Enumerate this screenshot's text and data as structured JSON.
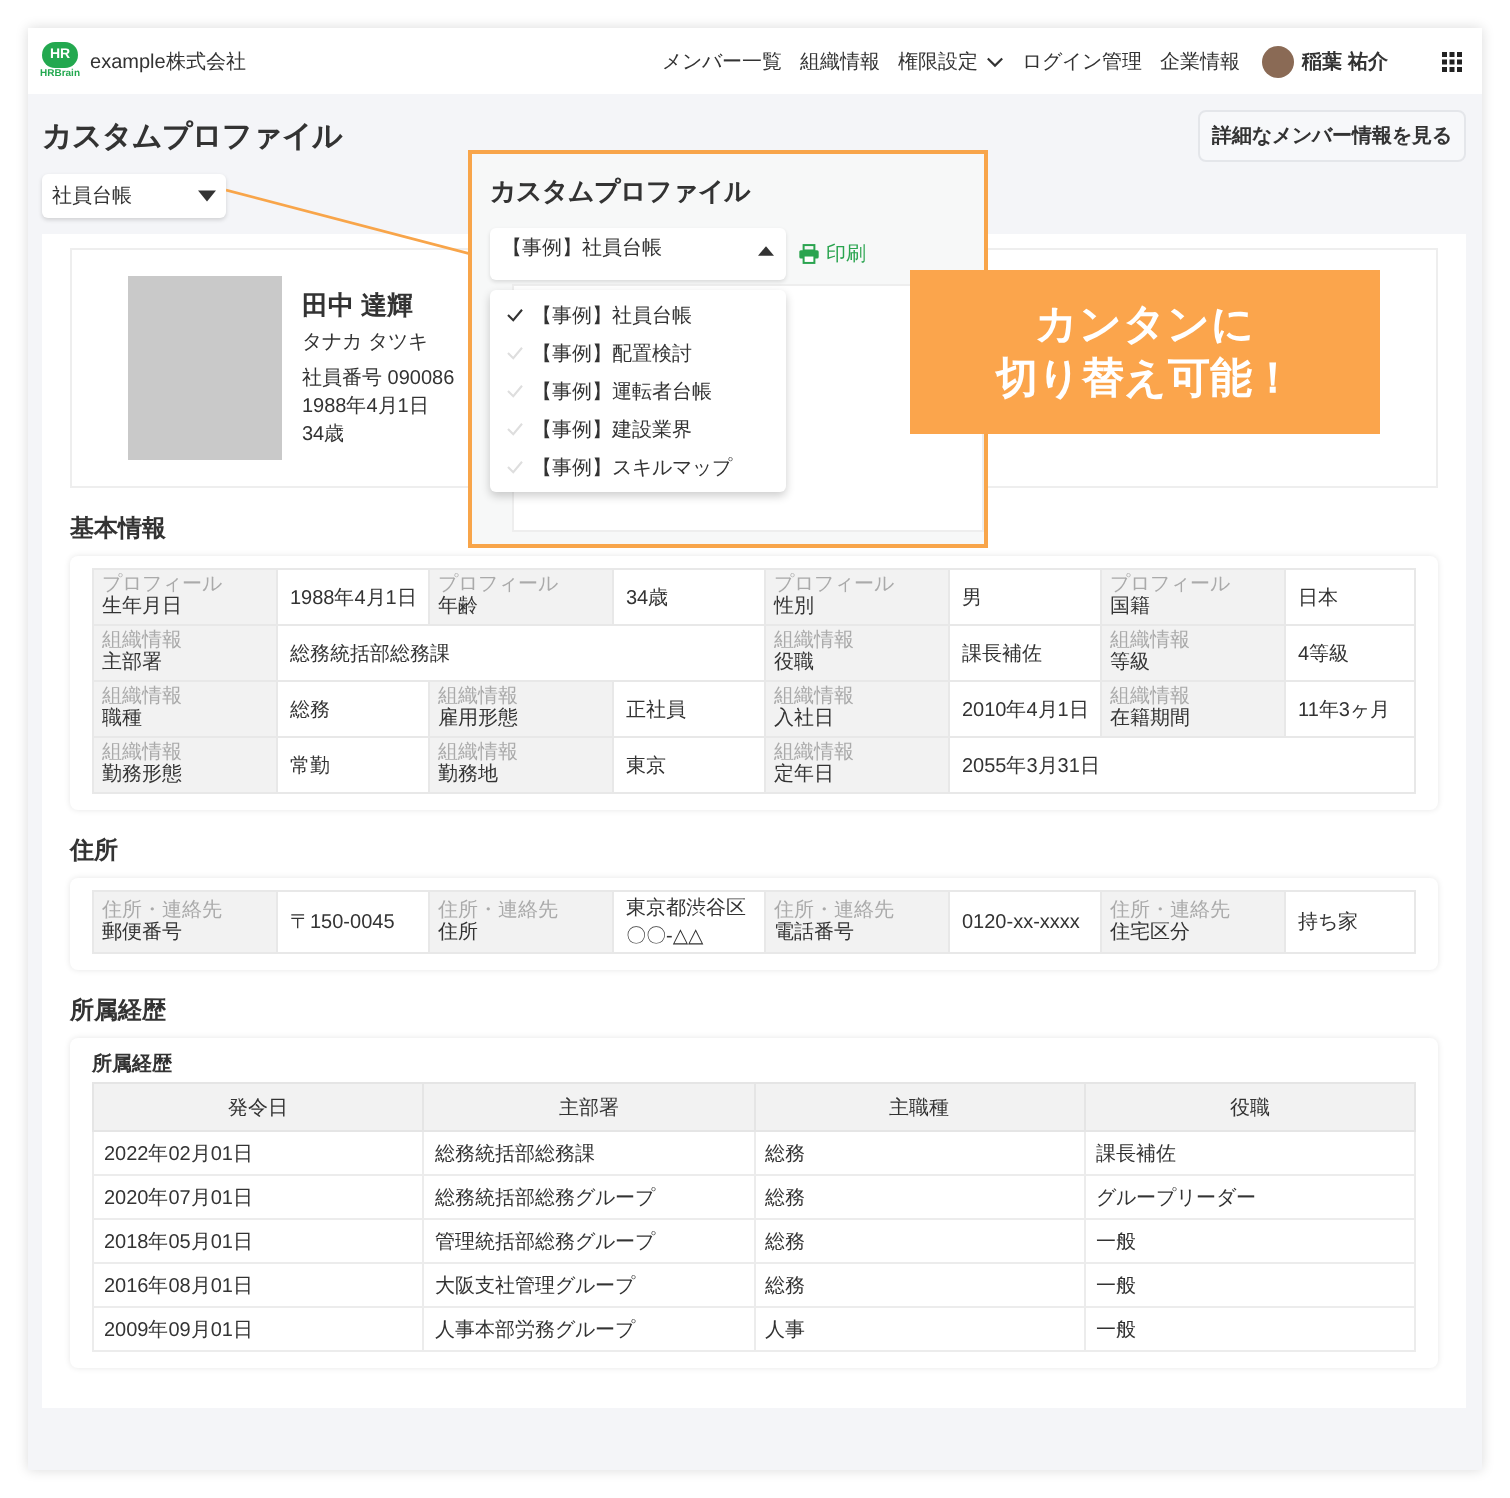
{
  "header": {
    "logo": {
      "mark": "HR",
      "wordmark": "HRBrain"
    },
    "company": "example株式会社",
    "nav": [
      {
        "label": "メンバー一覧",
        "kind": "link"
      },
      {
        "label": "組織情報",
        "kind": "link"
      },
      {
        "label": "権限設定",
        "kind": "menu"
      },
      {
        "label": "ログイン管理",
        "kind": "link"
      },
      {
        "label": "企業情報",
        "kind": "link"
      }
    ],
    "user": {
      "name": "稲葉 祐介"
    }
  },
  "page": {
    "title": "カスタムプロファイル",
    "detail_button": "詳細なメンバー情報を見る",
    "template_select": {
      "value": "社員台帳"
    }
  },
  "profile": {
    "name": "田中 達輝",
    "kana": "タナカ タツキ",
    "employee_no": "社員番号 090086",
    "birthday": "1988年4月1日",
    "age": "34歳"
  },
  "sections": [
    {
      "kind": "fields",
      "title": "基本情報",
      "rows": [
        [
          {
            "category": "プロフィール",
            "label": "生年月日",
            "value": "1988年4月1日"
          },
          {
            "category": "プロフィール",
            "label": "年齢",
            "value": "34歳"
          },
          {
            "category": "プロフィール",
            "label": "性別",
            "value": "男"
          },
          {
            "category": "プロフィール",
            "label": "国籍",
            "value": "日本"
          }
        ],
        [
          {
            "category": "組織情報",
            "label": "主部署",
            "value": "総務統括部総務課"
          },
          null,
          {
            "category": "組織情報",
            "label": "役職",
            "value": "課長補佐"
          },
          {
            "category": "組織情報",
            "label": "等級",
            "value": "4等級"
          }
        ],
        [
          {
            "category": "組織情報",
            "label": "職種",
            "value": "総務"
          },
          {
            "category": "組織情報",
            "label": "雇用形態",
            "value": "正社員"
          },
          {
            "category": "組織情報",
            "label": "入社日",
            "value": "2010年4月1日"
          },
          {
            "category": "組織情報",
            "label": "在籍期間",
            "value": "11年3ヶ月"
          }
        ],
        [
          {
            "category": "組織情報",
            "label": "勤務形態",
            "value": "常勤"
          },
          {
            "category": "組織情報",
            "label": "勤務地",
            "value": "東京"
          },
          {
            "category": "組織情報",
            "label": "定年日",
            "value": "2055年3月31日"
          },
          null
        ]
      ]
    },
    {
      "kind": "fields",
      "title": "住所",
      "rows": [
        [
          {
            "category": "住所・連絡先",
            "label": "郵便番号",
            "value": "〒150-0045"
          },
          {
            "category": "住所・連絡先",
            "label": "住所",
            "value": "東京都渋谷区〇〇-△△"
          },
          {
            "category": "住所・連絡先",
            "label": "電話番号",
            "value": "0120-xx-xxxx"
          },
          {
            "category": "住所・連絡先",
            "label": "住宅区分",
            "value": "持ち家"
          }
        ]
      ]
    },
    {
      "kind": "table",
      "title": "所属経歴",
      "caption": "所属経歴",
      "columns": [
        "発令日",
        "主部署",
        "主職種",
        "役職"
      ],
      "rows": [
        [
          "2022年02月01日",
          "総務統括部総務課",
          "総務",
          "課長補佐"
        ],
        [
          "2020年07月01日",
          "総務統括部総務グループ",
          "総務",
          "グループリーダー"
        ],
        [
          "2018年05月01日",
          "管理統括部総務グループ",
          "総務",
          "一般"
        ],
        [
          "2016年08月01日",
          "大阪支社管理グループ",
          "総務",
          "一般"
        ],
        [
          "2009年09月01日",
          "人事本部労務グループ",
          "人事",
          "一般"
        ]
      ]
    }
  ],
  "callout": {
    "title": "カスタムプロファイル",
    "select": {
      "value": "【事例】社員台帳",
      "expanded": true
    },
    "print": "印刷",
    "options": [
      {
        "label": "【事例】社員台帳",
        "selected": true
      },
      {
        "label": "【事例】配置検討",
        "selected": false
      },
      {
        "label": "【事例】運転者台帳",
        "selected": false
      },
      {
        "label": "【事例】建設業界",
        "selected": false
      },
      {
        "label": "【事例】スキルマップ",
        "selected": false
      }
    ]
  },
  "badge": {
    "lines": [
      "カンタンに",
      "切り替え可能！"
    ]
  }
}
